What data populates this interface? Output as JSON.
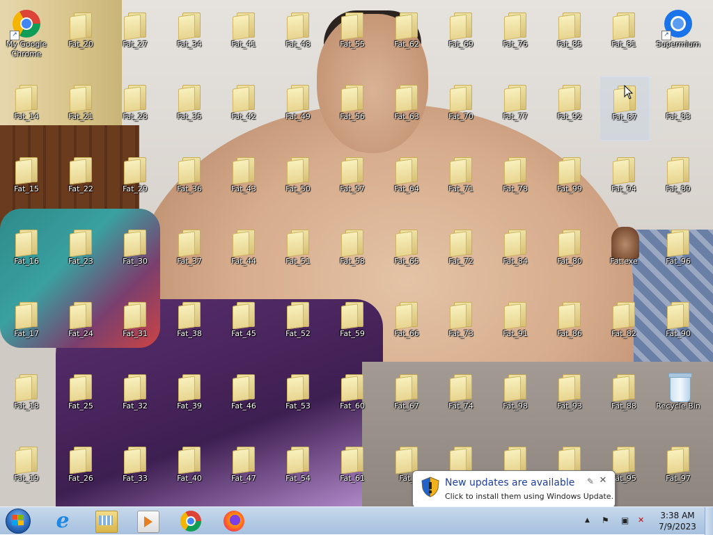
{
  "desktop": {
    "icons": [
      {
        "label": "My Google Chrome",
        "type": "chrome"
      },
      {
        "label": "Supermium",
        "type": "supermium"
      },
      {
        "label": "Fat.exe",
        "type": "exe"
      },
      {
        "label": "Recycle Bin",
        "type": "recycle"
      },
      {
        "label": "Fat_20"
      },
      {
        "label": "Fat_27"
      },
      {
        "label": "Fat_34"
      },
      {
        "label": "Fat_41"
      },
      {
        "label": "Fat_48"
      },
      {
        "label": "Fat_55"
      },
      {
        "label": "Fat_62"
      },
      {
        "label": "Fat_69"
      },
      {
        "label": "Fat_76"
      },
      {
        "label": "Fat_85"
      },
      {
        "label": "Fat_81"
      },
      {
        "label": "Fat_14"
      },
      {
        "label": "Fat_21"
      },
      {
        "label": "Fat_28"
      },
      {
        "label": "Fat_35"
      },
      {
        "label": "Fat_42"
      },
      {
        "label": "Fat_49"
      },
      {
        "label": "Fat_56"
      },
      {
        "label": "Fat_63"
      },
      {
        "label": "Fat_70"
      },
      {
        "label": "Fat_77"
      },
      {
        "label": "Fat_92"
      },
      {
        "label": "Fat_87",
        "selected": true
      },
      {
        "label": "Fat_83"
      },
      {
        "label": "Fat_15"
      },
      {
        "label": "Fat_22"
      },
      {
        "label": "Fat_29"
      },
      {
        "label": "Fat_36"
      },
      {
        "label": "Fat_43"
      },
      {
        "label": "Fat_50"
      },
      {
        "label": "Fat_57"
      },
      {
        "label": "Fat_64"
      },
      {
        "label": "Fat_71"
      },
      {
        "label": "Fat_78"
      },
      {
        "label": "Fat_99"
      },
      {
        "label": "Fat_94"
      },
      {
        "label": "Fat_89"
      },
      {
        "label": "Fat_16"
      },
      {
        "label": "Fat_23"
      },
      {
        "label": "Fat_30"
      },
      {
        "label": "Fat_37"
      },
      {
        "label": "Fat_44"
      },
      {
        "label": "Fat_51"
      },
      {
        "label": "Fat_58"
      },
      {
        "label": "Fat_65"
      },
      {
        "label": "Fat_72"
      },
      {
        "label": "Fat_84"
      },
      {
        "label": "Fat_80"
      },
      {
        "label": "Fat_96"
      },
      {
        "label": "Fat_17"
      },
      {
        "label": "Fat_24"
      },
      {
        "label": "Fat_31"
      },
      {
        "label": "Fat_38"
      },
      {
        "label": "Fat_45"
      },
      {
        "label": "Fat_52"
      },
      {
        "label": "Fat_59"
      },
      {
        "label": "Fat_66"
      },
      {
        "label": "Fat_73"
      },
      {
        "label": "Fat_91"
      },
      {
        "label": "Fat_86"
      },
      {
        "label": "Fat_82"
      },
      {
        "label": "Fat_90"
      },
      {
        "label": "Fat_18"
      },
      {
        "label": "Fat_25"
      },
      {
        "label": "Fat_32"
      },
      {
        "label": "Fat_39"
      },
      {
        "label": "Fat_46"
      },
      {
        "label": "Fat_53"
      },
      {
        "label": "Fat_60"
      },
      {
        "label": "Fat_67"
      },
      {
        "label": "Fat_74"
      },
      {
        "label": "Fat_98"
      },
      {
        "label": "Fat_93"
      },
      {
        "label": "Fat_88"
      },
      {
        "label": "Fat_19"
      },
      {
        "label": "Fat_26"
      },
      {
        "label": "Fat_33"
      },
      {
        "label": "Fat_40"
      },
      {
        "label": "Fat_47"
      },
      {
        "label": "Fat_54"
      },
      {
        "label": "Fat_61"
      },
      {
        "label": "Fat_"
      },
      {
        "label": ""
      },
      {
        "label": ""
      },
      {
        "label": ""
      },
      {
        "label": "Fat_95"
      },
      {
        "label": "Fat_97"
      }
    ]
  },
  "notification": {
    "title": "New updates are available",
    "body": "Click to install them using Windows Update.",
    "pin_glyph": "✎",
    "close_glyph": "✕"
  },
  "taskbar": {
    "pinned": [
      {
        "name": "internet-explorer",
        "icon": "ie-icon"
      },
      {
        "name": "windows-explorer",
        "icon": "folder-icon"
      },
      {
        "name": "windows-media-player",
        "icon": "media-player-icon"
      },
      {
        "name": "google-chrome",
        "icon": "chrome-icon"
      },
      {
        "name": "firefox",
        "icon": "firefox-icon"
      }
    ],
    "tray": {
      "show_hidden_glyph": "▲",
      "action_center_glyph": "⚑",
      "network_glyph": "▣",
      "volume_glyph": "✕"
    },
    "clock": {
      "time": "3:38 AM",
      "date": "7/9/2023"
    }
  }
}
